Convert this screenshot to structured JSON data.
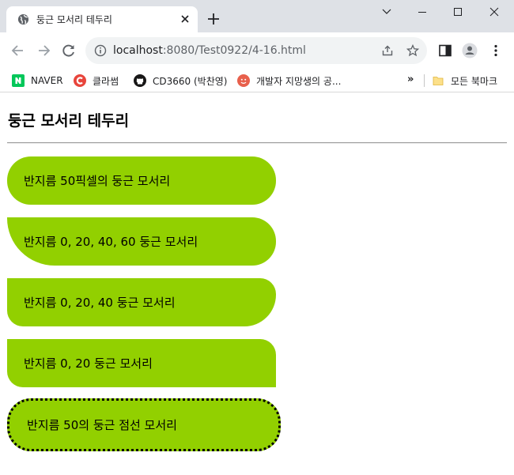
{
  "tab": {
    "title": "둥근 모서리 테두리",
    "close_symbol": "✕",
    "new_tab_symbol": "+"
  },
  "window_controls": [
    "chevron-down-icon",
    "minimize-icon",
    "maximize-icon",
    "close-icon"
  ],
  "address_bar": {
    "host": "localhost",
    "path": ":8080/Test0922/4-16.html"
  },
  "bookmarks": [
    {
      "label": "NAVER",
      "icon": "naver-icon",
      "color": "#03c75a"
    },
    {
      "label": "클라썸",
      "icon": "classum-icon",
      "color": "#e8453c"
    },
    {
      "label": "CD3660 (박찬영)",
      "icon": "github-icon",
      "color": "#181717"
    },
    {
      "label": "개발자 지망생의 공...",
      "icon": "blog-icon",
      "color": "#e8453c"
    }
  ],
  "bookmarks_overflow": "»",
  "all_bookmarks_label": "모든 북마크",
  "page": {
    "heading": "둥근 모서리 테두리",
    "boxes": [
      "반지름 50픽셀의 둥근 모서리",
      "반지름 0, 20, 40, 60 둥근 모서리",
      "반지름 0, 20, 40 둥근 모서리",
      "반지름 0, 20 둥근 모서리",
      "반지름 50의 둥근 점선 모서리"
    ]
  },
  "colors": {
    "box_fill": "#92d000",
    "tab_strip": "#dee1e6",
    "omnibox": "#f1f3f4"
  }
}
